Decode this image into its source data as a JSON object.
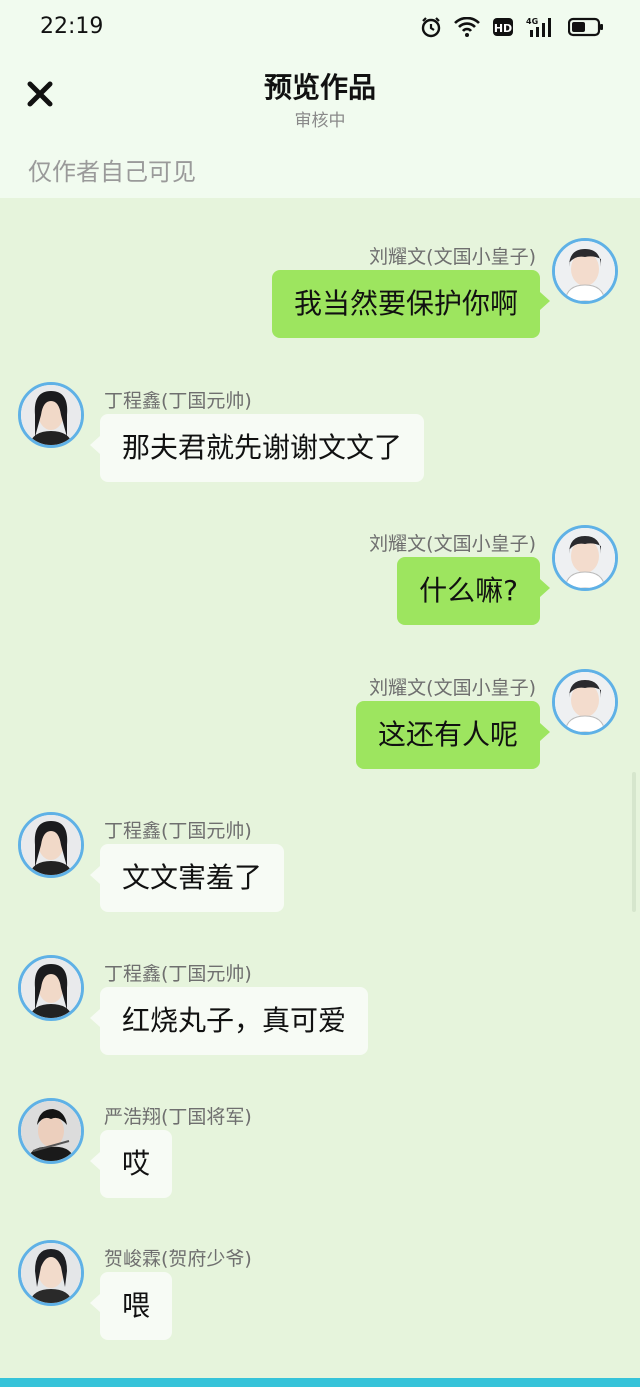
{
  "status_bar": {
    "time": "22:19",
    "network": "4G",
    "hd": "HD"
  },
  "header": {
    "title": "预览作品",
    "subtitle": "审核中",
    "visibility_note": "仅作者自己可见"
  },
  "messages": [
    {
      "side": "right",
      "name": "刘耀文(文国小皇子)",
      "text": "我当然要保护你啊"
    },
    {
      "side": "left",
      "name": "丁程鑫(丁国元帅)",
      "text": "那夫君就先谢谢文文了"
    },
    {
      "side": "right",
      "name": "刘耀文(文国小皇子)",
      "text": "什么嘛?"
    },
    {
      "side": "right",
      "name": "刘耀文(文国小皇子)",
      "text": "这还有人呢"
    },
    {
      "side": "left",
      "name": "丁程鑫(丁国元帅)",
      "text": "文文害羞了"
    },
    {
      "side": "left",
      "name": "丁程鑫(丁国元帅)",
      "text": "红烧丸子，真可爱"
    },
    {
      "side": "left",
      "name": "严浩翔(丁国将军)",
      "text": "哎"
    },
    {
      "side": "left",
      "name": "贺峻霖(贺府少爷)",
      "text": "喂"
    }
  ],
  "colors": {
    "chat_bg": "#e6f4dc",
    "right_bubble": "#9de55f",
    "left_bubble": "#f7fbf5",
    "avatar_ring": "#5fb1e6"
  }
}
